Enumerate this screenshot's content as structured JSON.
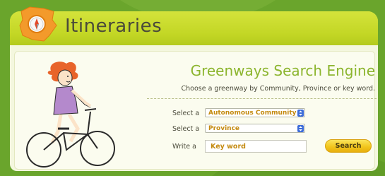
{
  "header": {
    "title": "Itineraries",
    "badge_icon": "spain-map-compass-icon"
  },
  "search_engine": {
    "title": "Greenways Search Engine",
    "subtitle": "Choose a greenway by Community, Province or key word.",
    "rows": [
      {
        "label": "Select a",
        "value": "Autonomous Community"
      },
      {
        "label": "Select a",
        "value": "Province"
      }
    ],
    "keyword": {
      "label": "Write a",
      "placeholder": "Key word"
    },
    "search_label": "Search"
  },
  "colors": {
    "background": "#6aa52c",
    "header": "#c5d928",
    "title_green": "#8cb52e",
    "button_yellow": "#f1c41a",
    "field_text": "#c48a10"
  }
}
